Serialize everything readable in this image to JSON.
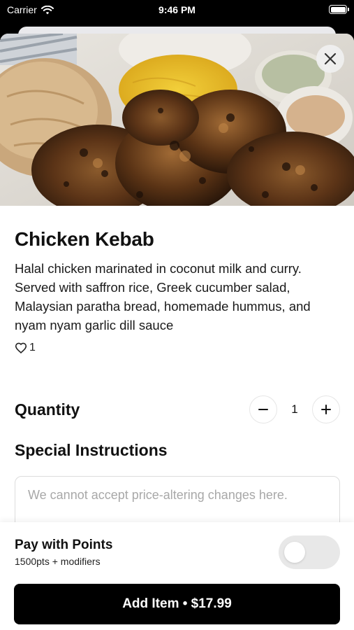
{
  "status_bar": {
    "carrier": "Carrier",
    "time": "9:46 PM",
    "icons": [
      "wifi-icon",
      "battery-icon"
    ]
  },
  "hero": {
    "close_icon": "close-icon"
  },
  "item": {
    "title": "Chicken Kebab",
    "description": "Halal chicken marinated in coconut milk and curry. Served with saffron rice, Greek cucumber salad, Malaysian paratha bread, homemade hummus, and nyam nyam garlic dill sauce",
    "likes": "1",
    "like_icon": "heart-outline-icon"
  },
  "quantity": {
    "label": "Quantity",
    "value": "1",
    "minus_icon": "minus-icon",
    "plus_icon": "plus-icon"
  },
  "special_instructions": {
    "label": "Special Instructions",
    "placeholder": "We cannot accept price-altering changes here.",
    "value": ""
  },
  "points": {
    "title": "Pay with Points",
    "subtitle": "1500pts + modifiers",
    "toggle_on": false
  },
  "add_button": {
    "label": "Add Item • $17.99"
  },
  "colors": {
    "primary": "#000000",
    "background": "#ffffff",
    "toggle_off": "#e8e8e8",
    "placeholder": "#a8a8a8"
  }
}
